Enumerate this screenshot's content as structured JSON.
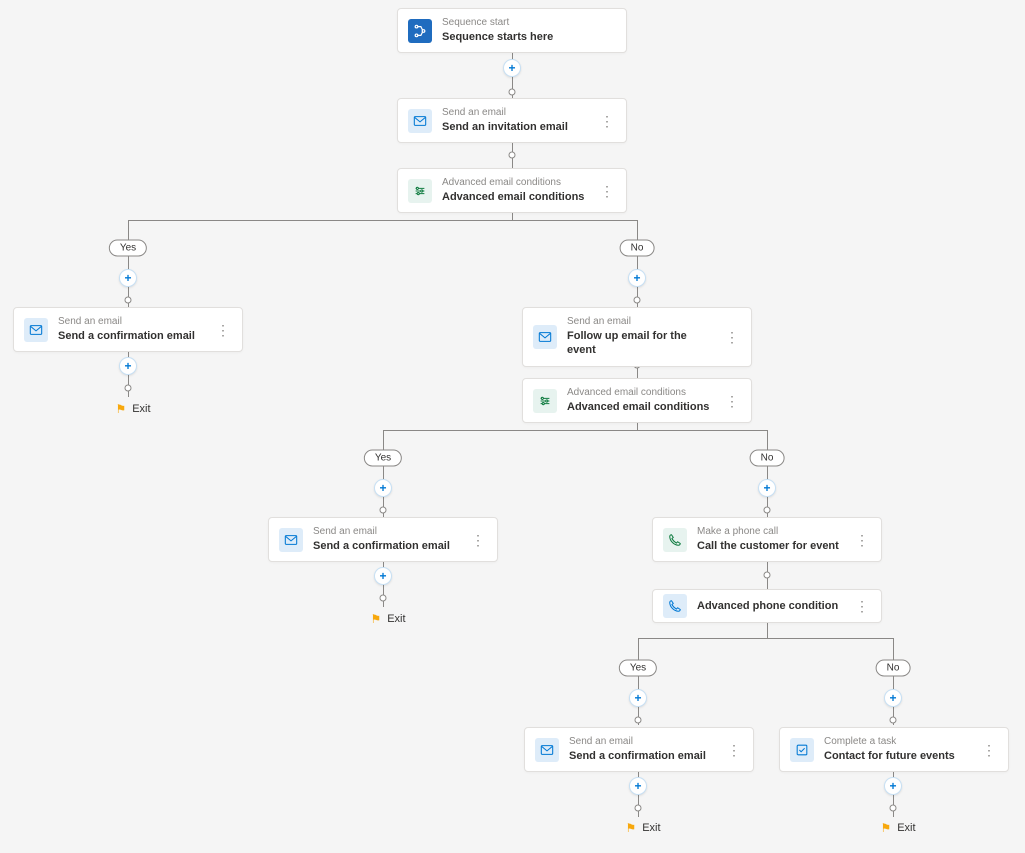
{
  "nodes": {
    "start": {
      "type": "Sequence start",
      "title": "Sequence starts here"
    },
    "email1": {
      "type": "Send an email",
      "title": "Send an invitation email"
    },
    "cond1": {
      "type": "Advanced email conditions",
      "title": "Advanced email conditions"
    },
    "confirmA": {
      "type": "Send an email",
      "title": "Send a confirmation email"
    },
    "followup": {
      "type": "Send an email",
      "title": "Follow up email for the event"
    },
    "cond2": {
      "type": "Advanced email conditions",
      "title": "Advanced email conditions"
    },
    "confirmB": {
      "type": "Send an email",
      "title": "Send a confirmation email"
    },
    "call": {
      "type": "Make a phone call",
      "title": "Call the customer for event"
    },
    "phonecond": {
      "type": "",
      "title": "Advanced phone condition"
    },
    "confirmC": {
      "type": "Send an email",
      "title": "Send a confirmation email"
    },
    "task": {
      "type": "Complete a task",
      "title": "Contact for future events"
    }
  },
  "labels": {
    "yes": "Yes",
    "no": "No",
    "exit": "Exit"
  }
}
